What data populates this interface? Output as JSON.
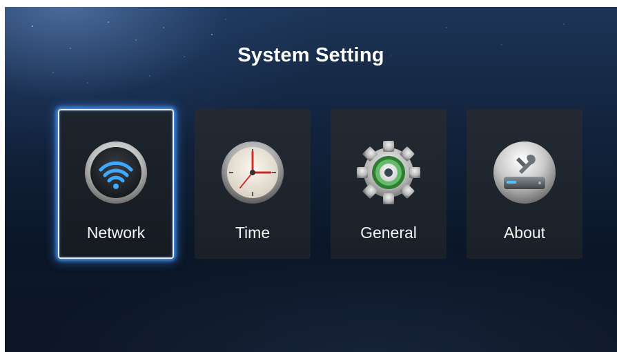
{
  "header": {
    "title": "System Setting"
  },
  "menu": {
    "selected": "Network",
    "items": [
      {
        "label": "Network",
        "icon": "wifi-icon"
      },
      {
        "label": "Time",
        "icon": "clock-icon"
      },
      {
        "label": "General",
        "icon": "gear-icon"
      },
      {
        "label": "About",
        "icon": "disk-tools-icon"
      }
    ]
  },
  "colors": {
    "selection_glow": "#4a9fff",
    "gear_accent": "#4caf50",
    "clock_hand": "#e53935"
  }
}
